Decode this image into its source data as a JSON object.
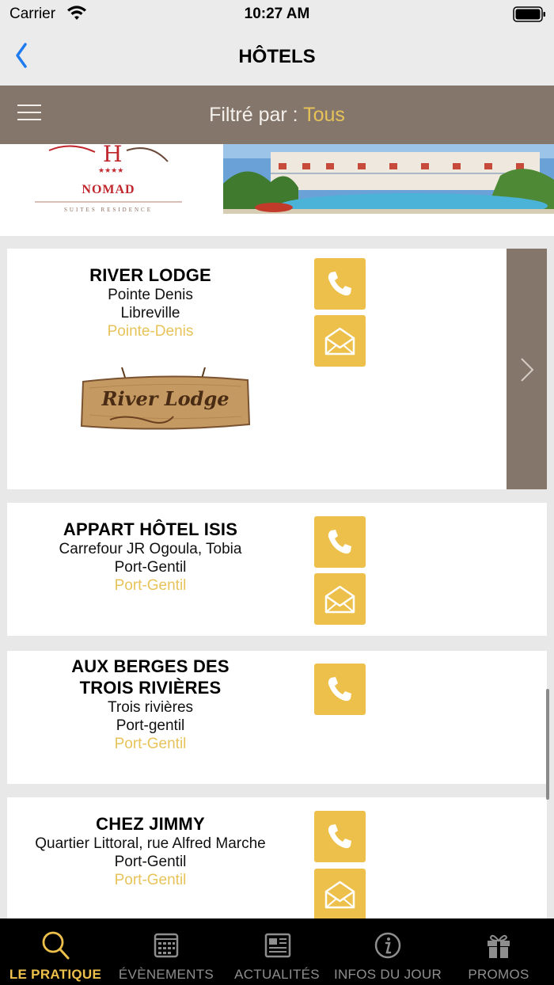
{
  "status_bar": {
    "carrier": "Carrier",
    "time": "10:27 AM"
  },
  "nav": {
    "title": "HÔTELS",
    "back_icon": "chevron-left-icon"
  },
  "filter": {
    "label": "Filtré par : ",
    "value": "Tous"
  },
  "banner": {
    "brand": "NOMAD",
    "brand_sub": "SUITES RESIDENCE"
  },
  "hotels": [
    {
      "name": "RIVER LODGE",
      "address": "Pointe Denis",
      "city": "Libreville",
      "district": "Pointe-Denis",
      "logo_text": "River Lodge",
      "has_phone": true,
      "has_email": true,
      "has_details": true
    },
    {
      "name": "APPART HÔTEL ISIS",
      "address": "Carrefour JR Ogoula, Tobia",
      "city": "Port-Gentil",
      "district": "Port-Gentil",
      "has_phone": true,
      "has_email": true
    },
    {
      "name_line1": "AUX BERGES DES",
      "name_line2": "TROIS RIVIÈRES",
      "address": "Trois rivières",
      "city": "Port-gentil",
      "district": "Port-Gentil",
      "has_phone": true,
      "has_email": false
    },
    {
      "name": "CHEZ JIMMY",
      "address": "Quartier Littoral, rue Alfred Marche",
      "city": "Port-Gentil",
      "district": "Port-Gentil",
      "has_phone": true,
      "has_email": true
    }
  ],
  "tabs": [
    {
      "label": "LE PRATIQUE",
      "icon": "search-icon",
      "active": true
    },
    {
      "label": "ÉVÈNEMENTS",
      "icon": "calendar-icon",
      "active": false
    },
    {
      "label": "ACTUALITÉS",
      "icon": "newspaper-icon",
      "active": false
    },
    {
      "label": "INFOS DU JOUR",
      "icon": "info-icon",
      "active": false
    },
    {
      "label": "PROMOS",
      "icon": "gift-icon",
      "active": false
    }
  ],
  "colors": {
    "accent": "#ECC04A",
    "filter_bar": "#84766B",
    "nav_bg": "#EBEBEB",
    "back_blue": "#1E7CF0",
    "tab_bar": "#000000"
  }
}
